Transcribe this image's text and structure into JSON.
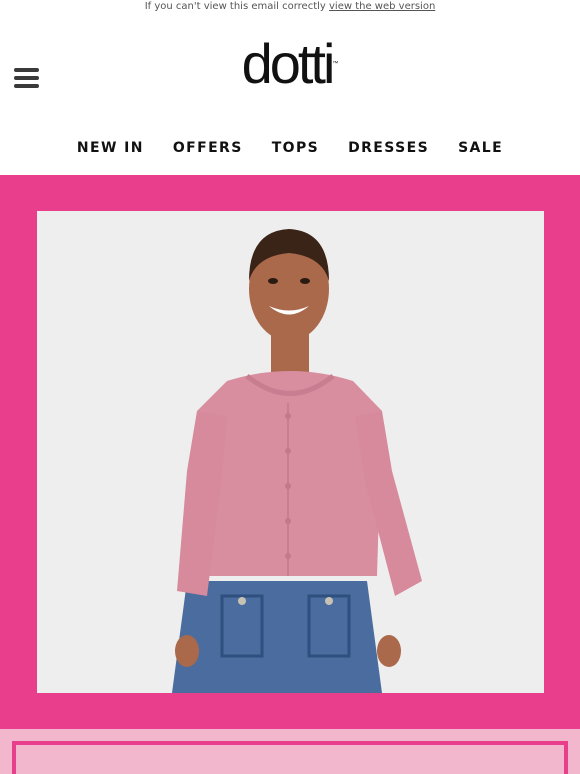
{
  "preheader": {
    "text": "If you can't view this email correctly",
    "link_label": "view the web version"
  },
  "header": {
    "logo_text": "dotti",
    "logo_tm": "™",
    "menu_icon": "hamburger-menu-icon"
  },
  "nav": {
    "items": [
      {
        "label": "NEW IN"
      },
      {
        "label": "OFFERS"
      },
      {
        "label": "TOPS"
      },
      {
        "label": "DRESSES"
      },
      {
        "label": "SALE"
      }
    ]
  },
  "colors": {
    "brand_pink": "#e83e8c",
    "light_pink": "#f2b6cd",
    "cardigan_pink": "#d98ea0",
    "denim": "#4a6c9e"
  }
}
